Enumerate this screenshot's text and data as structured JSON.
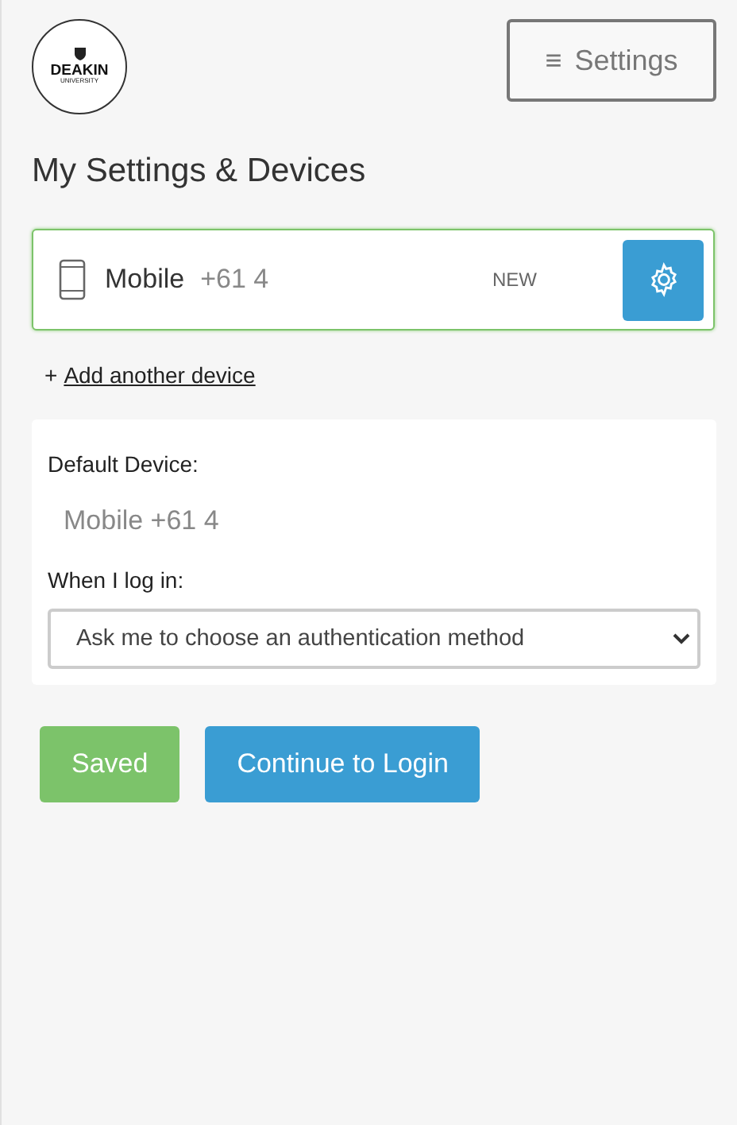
{
  "logo": {
    "name": "DEAKIN",
    "subtitle": "UNIVERSITY"
  },
  "menu_button": {
    "icon": "≡",
    "label": "Settings"
  },
  "title": "My Settings & Devices",
  "devices": [
    {
      "name": "Mobile",
      "number": "+61 4",
      "badge": "NEW",
      "selected": true
    }
  ],
  "add_device": {
    "prefix": "+",
    "label": "Add another device"
  },
  "default_device": {
    "label": "Default Device:",
    "value": "Mobile +61 4"
  },
  "login": {
    "label": "When I log in:",
    "value": "Ask me to choose an authentication method"
  },
  "buttons": [
    {
      "label": "Saved",
      "kind": "saved"
    },
    {
      "label": "Continue to Login",
      "kind": "primary"
    }
  ]
}
